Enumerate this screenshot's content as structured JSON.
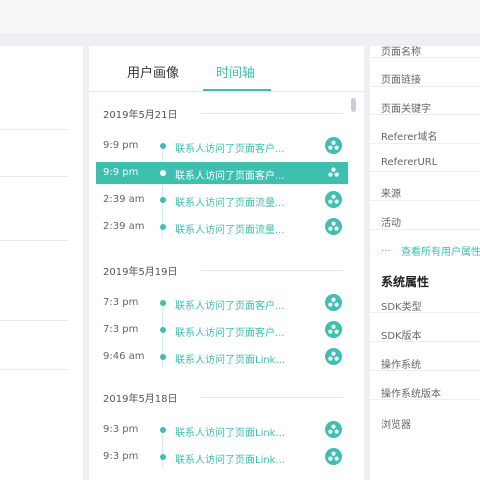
{
  "tabs": {
    "profile": "用户画像",
    "timeline": "时间轴"
  },
  "timeline": {
    "groups": [
      {
        "date": "2019年5月21日",
        "events": [
          {
            "time": "9:9 pm",
            "text": "联系人访问了页面客户..."
          },
          {
            "time": "9:9 pm",
            "text": "联系人访问了页面客户...",
            "highlighted": true
          },
          {
            "time": "2:39 am",
            "text": "联系人访问了页面流量..."
          },
          {
            "time": "2:39 am",
            "text": "联系人访问了页面流量..."
          }
        ]
      },
      {
        "date": "2019年5月19日",
        "events": [
          {
            "time": "7:3 pm",
            "text": "联系人访问了页面客户..."
          },
          {
            "time": "7:3 pm",
            "text": "联系人访问了页面客户..."
          },
          {
            "time": "9:46 am",
            "text": "联系人访问了页面Link..."
          }
        ]
      },
      {
        "date": "2019年5月18日",
        "events": [
          {
            "time": "9:3 pm",
            "text": "联系人访问了页面Link..."
          },
          {
            "time": "9:3 pm",
            "text": "联系人访问了页面Link..."
          }
        ]
      }
    ],
    "event_icon": "device-icon"
  },
  "attributes": {
    "user_fields": [
      "页面名称",
      "页面链接",
      "页面关键字",
      "Referer域名",
      "RefererURL",
      "来源",
      "活动"
    ],
    "view_all_prefix": "...",
    "view_all": "查看所有用户属性",
    "system_title": "系统属性",
    "system_fields": [
      "SDK类型",
      "SDK版本",
      "操作系统",
      "操作系统版本",
      "浏览器"
    ]
  },
  "colors": {
    "accent": "#3fbfb0",
    "background": "#eef1f4"
  }
}
